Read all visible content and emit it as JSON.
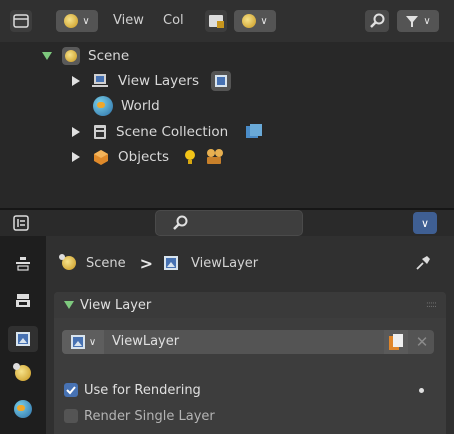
{
  "outliner": {
    "header": {
      "view_label": "View",
      "col_label": "Col"
    },
    "tree": [
      {
        "label": "Scene",
        "expand": "down"
      },
      {
        "label": "View Layers",
        "expand": "right"
      },
      {
        "label": "World",
        "expand": "none"
      },
      {
        "label": "Scene Collection",
        "expand": "right"
      },
      {
        "label": "Objects",
        "expand": "right"
      }
    ]
  },
  "properties": {
    "breadcrumb": {
      "scene": "Scene",
      "separator": ">",
      "view_layer": "ViewLayer"
    },
    "panel_title": "View Layer",
    "view_layer_field": "ViewLayer",
    "use_for_rendering": {
      "label": "Use for Rendering",
      "checked": true
    },
    "render_single_layer": {
      "label": "Render Single Layer",
      "checked": false
    }
  },
  "colors": {
    "accent_blue": "#4772b3",
    "expand_green": "#7ec97e"
  }
}
